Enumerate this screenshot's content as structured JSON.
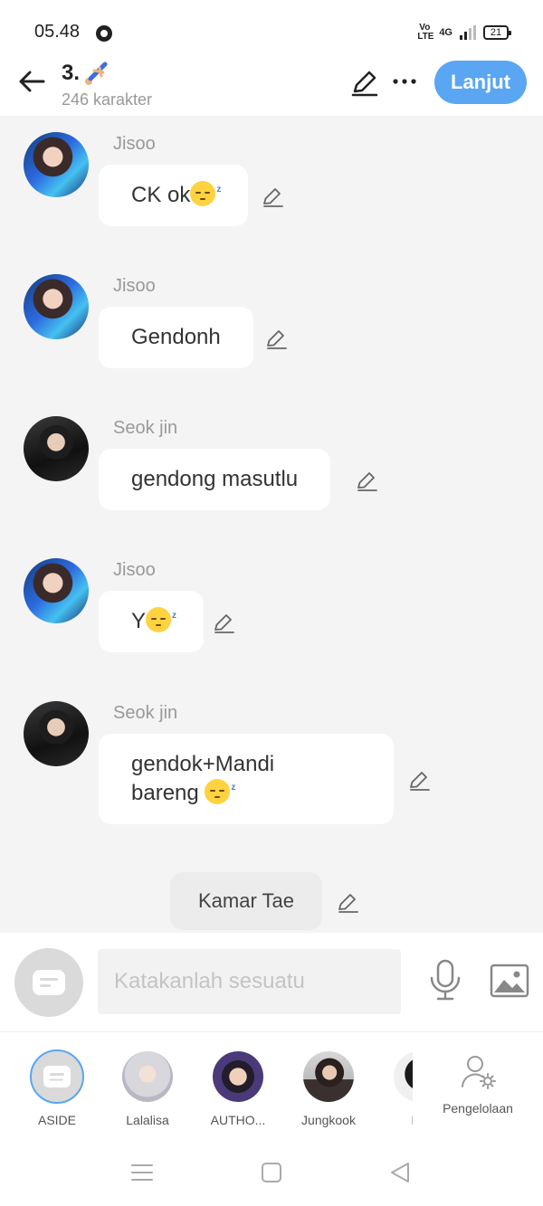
{
  "status_bar": {
    "time": "05.48",
    "network_type": "4G",
    "volte": "Vo LTE",
    "battery": "21"
  },
  "header": {
    "title": "3.",
    "subtitle": "246 karakter",
    "next_label": "Lanjut"
  },
  "messages": [
    {
      "sender": "Jisoo",
      "text": "CK ok",
      "has_emoji": true
    },
    {
      "sender": "Jisoo",
      "text": "Gendonh",
      "has_emoji": false
    },
    {
      "sender": "Seok jin",
      "text": "gendong masutlu",
      "has_emoji": false
    },
    {
      "sender": "Jisoo",
      "text": "Y",
      "has_emoji": true
    },
    {
      "sender": "Seok jin",
      "text_line1": "gendok+Mandi",
      "text_line2": "bareng ",
      "has_emoji": true
    }
  ],
  "aside_message": {
    "text": "Kamar Tae"
  },
  "composer": {
    "placeholder": "Katakanlah sesuatu"
  },
  "characters": [
    {
      "name": "ASIDE"
    },
    {
      "name": "Lalalisa"
    },
    {
      "name": "AUTHO..."
    },
    {
      "name": "Jungkook"
    },
    {
      "name": "Kir"
    }
  ],
  "management": {
    "label": "Pengelolaan"
  },
  "colors": {
    "accent": "#5aa6f3",
    "background": "#f4f4f4",
    "bubble": "#ffffff",
    "emoji": "#ffd23f"
  },
  "icons": [
    "back-arrow-icon",
    "pencil-icon",
    "more-icon",
    "mic-icon",
    "image-icon",
    "person-gear-icon",
    "aside-bubble-icon",
    "sleeping-face-emoji"
  ]
}
